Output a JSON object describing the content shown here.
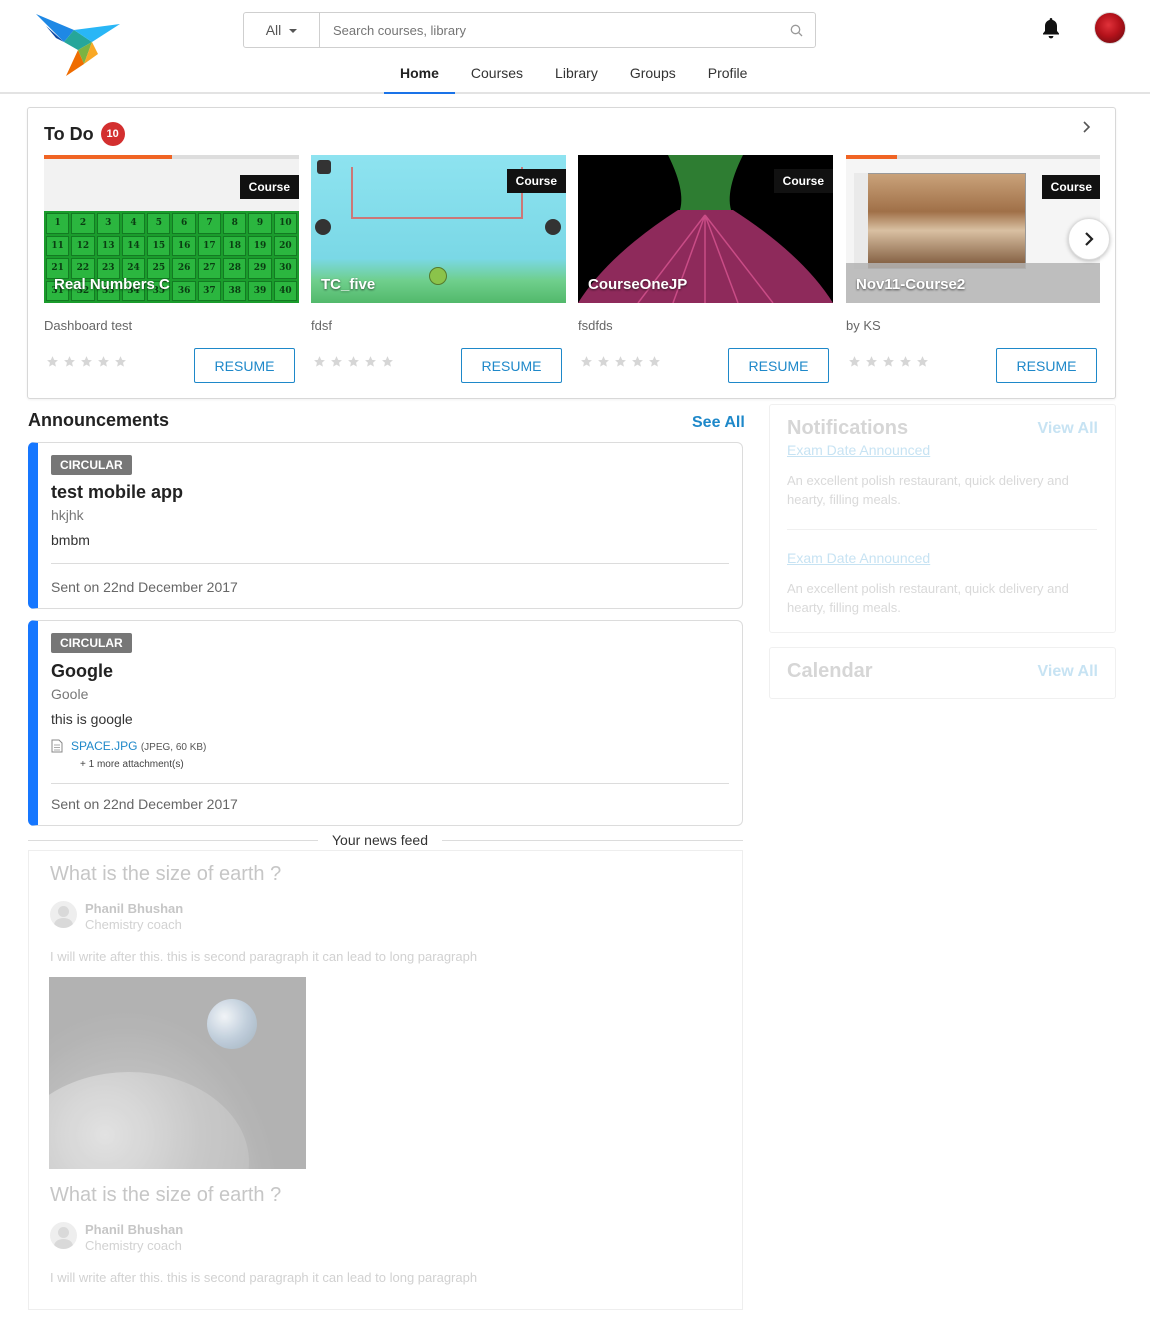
{
  "header": {
    "search_scope": "All",
    "search_placeholder": "Search courses, library",
    "nav": [
      "Home",
      "Courses",
      "Library",
      "Groups",
      "Profile"
    ],
    "active_nav": "Home"
  },
  "todo": {
    "title": "To Do",
    "count": "10",
    "cards": [
      {
        "title": "Real Numbers C",
        "tag": "Course",
        "author": "Dashboard test",
        "progress": 0.5,
        "button": "RESUME",
        "rating": 0
      },
      {
        "title": "TC_five",
        "tag": "Course",
        "author": "fdsf",
        "progress": 0,
        "button": "RESUME",
        "rating": 0
      },
      {
        "title": "CourseOneJP",
        "tag": "Course",
        "author": "fsdfds",
        "progress": 0,
        "button": "RESUME",
        "rating": 0
      },
      {
        "title": "Nov11-Course2",
        "tag": "Course",
        "author": "by KS",
        "progress": 0.2,
        "button": "RESUME",
        "rating": 0
      }
    ],
    "number_grid": [
      "1",
      "2",
      "3",
      "4",
      "5",
      "6",
      "7",
      "8",
      "9",
      "10",
      "11",
      "12",
      "13",
      "14",
      "15",
      "16",
      "17",
      "18",
      "19",
      "20",
      "21",
      "22",
      "23",
      "24",
      "25",
      "26",
      "27",
      "28",
      "29",
      "30",
      "31",
      "32",
      "33",
      "34",
      "35",
      "36",
      "37",
      "38",
      "39",
      "40"
    ]
  },
  "announcements": {
    "title": "Announcements",
    "see_all": "See All",
    "items": [
      {
        "tag": "CIRCULAR",
        "title": "test mobile app",
        "subtitle": "hkjhk",
        "body": "bmbm",
        "sent": "Sent on 22nd December 2017"
      },
      {
        "tag": "CIRCULAR",
        "title": "Google",
        "subtitle": "Goole",
        "body": "this is google",
        "attachment_name": "SPACE.JPG",
        "attachment_meta": "(JPEG, 60 KB)",
        "more_attachments": "+ 1 more attachment(s)",
        "sent": "Sent on 22nd December 2017"
      }
    ]
  },
  "feed": {
    "label": "Your news feed",
    "posts": [
      {
        "question": "What is the size of earth ?",
        "name": "Phanil Bhushan",
        "role": "Chemistry coach",
        "text": "I will write after this. this is second paragraph it can lead to long paragraph"
      },
      {
        "question": "What is the size of earth ?",
        "name": "Phanil Bhushan",
        "role": "Chemistry coach",
        "text": "I will write after this. this is second paragraph it can lead to long paragraph"
      }
    ]
  },
  "notifications": {
    "title": "Notifications",
    "view_all": "View All",
    "items": [
      {
        "title": "Exam Date Announced",
        "text": "An excellent polish restaurant, quick delivery and hearty, filling meals."
      },
      {
        "title": "Exam Date Announced",
        "text": "An excellent polish restaurant, quick delivery and hearty, filling meals."
      }
    ]
  },
  "calendar": {
    "title": "Calendar",
    "view_all": "View All"
  },
  "colors": {
    "accent": "#1e88c9",
    "nav_underline": "#1a73e8",
    "announcement_bar": "#1677ff",
    "badge": "#d32f2f",
    "progress": "#f06424"
  }
}
